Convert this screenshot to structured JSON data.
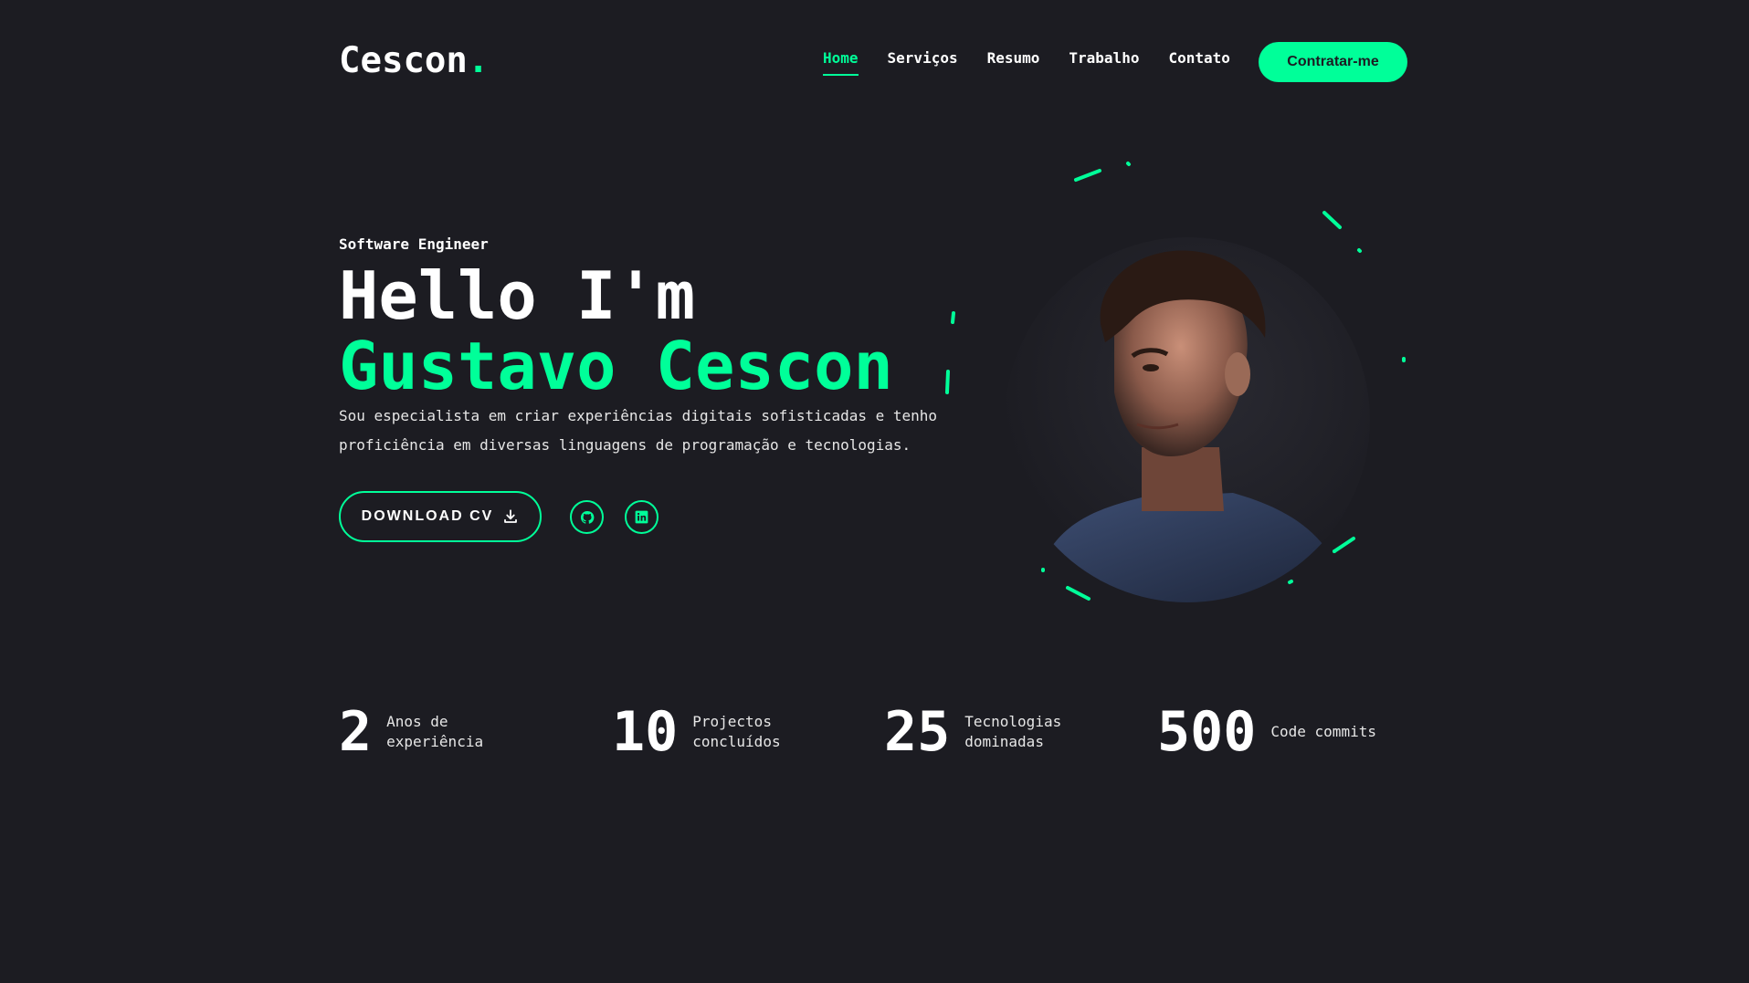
{
  "header": {
    "logo": "Cescon",
    "logo_dot": ".",
    "nav": [
      "Home",
      "Serviços",
      "Resumo",
      "Trabalho",
      "Contato"
    ],
    "hire_label": "Contratar-me"
  },
  "hero": {
    "role": "Software Engineer",
    "greeting": "Hello I'm",
    "name": "Gustavo Cescon",
    "description": "Sou especialista em criar experiências digitais sofisticadas e tenho proficiência em diversas linguagens de programação e tecnologias.",
    "download_label": "DOWNLOAD CV",
    "icons": {
      "download": "download-icon",
      "github": "github-icon",
      "linkedin": "linkedin-icon"
    }
  },
  "stats": [
    {
      "value": "2",
      "label": "Anos de experiência"
    },
    {
      "value": "10",
      "label": "Projectos concluídos"
    },
    {
      "value": "25",
      "label": "Tecnologias dominadas"
    },
    {
      "value": "500",
      "label": "Code commits"
    }
  ],
  "colors": {
    "background": "#1c1c22",
    "accent": "#00ff99",
    "text": "#ffffff"
  }
}
